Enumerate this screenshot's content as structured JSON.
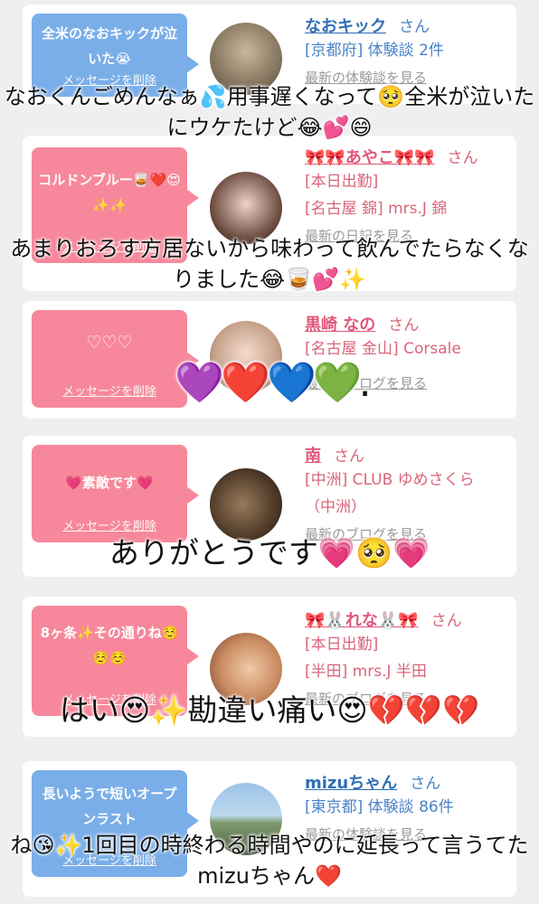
{
  "cards": [
    {
      "bubble_text": "全米のなおキックが泣いた😭",
      "delete_label": "メッセージを削除",
      "name": "なおキック",
      "san": "さん",
      "lines": [
        "[京都府] 体験談 2件"
      ],
      "link": "最新の体験談を見る",
      "color": "#7aaee8"
    },
    {
      "bubble_text": "コルドンブルー🥃❤️😍✨✨",
      "delete_label": "メッセージを削除",
      "name": "🎀🎀あやこ🎀🎀",
      "san": "さん",
      "lines": [
        "[本日出勤]",
        "[名古屋 錦] mrs.J 錦"
      ],
      "link": "最新の日記を見る",
      "color": "#f7889b"
    },
    {
      "bubble_text": "♡♡♡",
      "delete_label": "メッセージを削除",
      "name": "黒崎 なの",
      "san": "さん",
      "lines": [
        "[名古屋 金山] Corsale"
      ],
      "link": "最新のブログを見る",
      "color": "#f7889b"
    },
    {
      "bubble_text": "💗素敵です💗",
      "delete_label": "メッセージを削除",
      "name": "南",
      "san": "さん",
      "lines": [
        "[中洲] CLUB ゆめさくら（中洲）"
      ],
      "link": "最新のブログを見る",
      "color": "#f7889b"
    },
    {
      "bubble_text": "8ヶ条✨その通りね☺️☺️☺️",
      "delete_label": "メッセージを削除",
      "name": "🎀🐰れな🐰🎀",
      "san": "さん",
      "lines": [
        "[本日出勤]",
        "[半田] mrs.J 半田"
      ],
      "link": "最新のブログを見る",
      "color": "#f7889b"
    },
    {
      "bubble_text": "長いようで短いオープンラスト",
      "delete_label": "メッセージを削除",
      "name": "mizuちゃん",
      "san": "さん",
      "lines": [
        "[東京都] 体験談 86件"
      ],
      "link": "最新の体験談を見る",
      "color": "#7aaee8"
    }
  ],
  "overlays": {
    "o1": "なおくんごめんなぁ💦用事遅くなって🥺全米が泣いたにウケたけど😂💕😄",
    "o2": "あまりおろす方居ないから味わって飲んでたらなくなりました😂🥃💕✨",
    "o3": "💜❤️💙💚.",
    "o4": "ありがとうです💗🥺💗",
    "o5": "はい😍✨勘違い痛い😍💔💔💔",
    "o6": "ね😘✨1回目の時終わる時間やのに延長って言うてたmizuちゃん❤️"
  }
}
